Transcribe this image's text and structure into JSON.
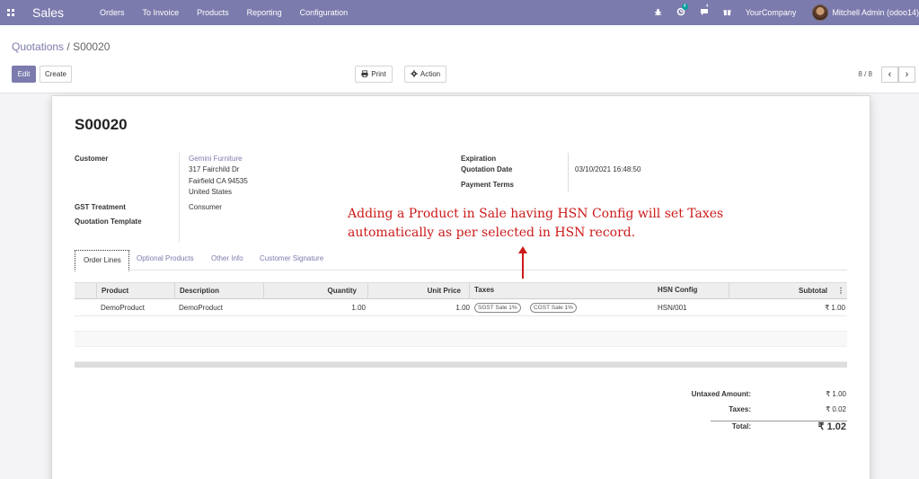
{
  "navbar": {
    "app_name": "Sales",
    "menu": [
      "Orders",
      "To Invoice",
      "Products",
      "Reporting",
      "Configuration"
    ],
    "bug_icon": "bug-icon",
    "activity_count": "4",
    "message_count": "4",
    "company": "YourCompany",
    "user": "Mitchell Admin (odoo14)",
    "color": "#7c7bad"
  },
  "breadcrumb": {
    "parent": "Quotations",
    "separator": "/",
    "current": "S00020"
  },
  "buttons": {
    "edit": "Edit",
    "create": "Create",
    "print": "Print",
    "action": "Action"
  },
  "pager": {
    "value": "8 / 8",
    "prev": "‹",
    "next": "›"
  },
  "form": {
    "name": "S00020",
    "customer_label": "Customer",
    "customer_name": "Gemini Furniture",
    "customer_street": "317 Fairchild Dr",
    "customer_city": "Fairfield CA 94535",
    "customer_country": "United States",
    "gst_label": "GST Treatment",
    "gst_value": "Consumer",
    "template_label": "Quotation Template",
    "expiration_label": "Expiration",
    "quotation_date_label": "Quotation Date",
    "quotation_date_value": "03/10/2021 16:48:50",
    "payment_terms_label": "Payment Terms"
  },
  "tabs": [
    "Order Lines",
    "Optional Products",
    "Other Info",
    "Customer Signature"
  ],
  "table": {
    "headers": [
      "Product",
      "Description",
      "Quantity",
      "Unit Price",
      "Taxes",
      "HSN Config",
      "Subtotal"
    ],
    "rows": [
      {
        "product": "DemoProduct",
        "description": "DemoProduct",
        "quantity": "1.00",
        "unit_price": "1.00",
        "taxes": [
          "SGST Sale 1%",
          "CGST Sale 1%"
        ],
        "hsn_config": "HSN/001",
        "subtotal": "₹ 1.00"
      }
    ]
  },
  "totals": {
    "untaxed_label": "Untaxed Amount:",
    "untaxed_value": "₹ 1.00",
    "taxes_label": "Taxes:",
    "taxes_value": "₹ 0.02",
    "total_label": "Total:",
    "total_value": "₹ 1.02"
  },
  "annotation": {
    "line1": "Adding a Product in Sale having HSN Config will set Taxes",
    "line2": "automatically as per selected in HSN record.",
    "color": "#cc1a1a"
  }
}
